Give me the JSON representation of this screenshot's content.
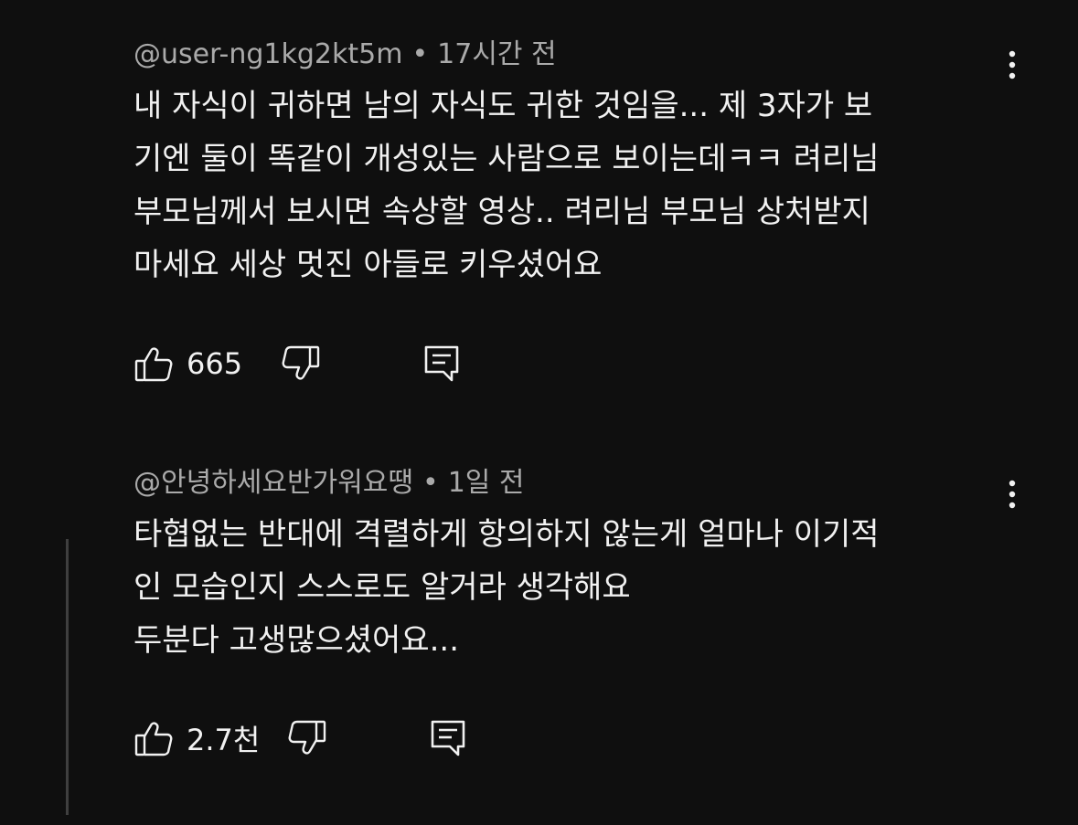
{
  "comments": [
    {
      "author": "@user-ng1kg2kt5m",
      "separator": "•",
      "time": "17시간 전",
      "text": "내 자식이 귀하면 남의 자식도 귀한 것임을... 제 3자가 보\n기엔 둘이 똑같이 개성있는 사람으로 보이는데ㅋㅋ 려리님\n부모님께서 보시면 속상할 영상.. 려리님 부모님 상처받지\n마세요 세상 멋진 아들로 키우셨어요",
      "likes": "665"
    },
    {
      "author": "@안녕하세요반가워요땡",
      "separator": "•",
      "time": "1일 전",
      "text": "타협없는 반대에 격렬하게 항의하지 않는게 얼마나 이기적\n인 모습인지 스스로도 알거라 생각해요\n두분다 고생많으셨어요...",
      "likes": "2.7천"
    }
  ],
  "icons": {
    "like": "thumbs-up-icon",
    "dislike": "thumbs-down-icon",
    "reply": "reply-comment-icon",
    "menu": "more-vert-icon"
  },
  "colors": {
    "background": "#0f0f0f",
    "text": "#f1f1f1",
    "meta": "#aaaaaa",
    "thread_line": "#3f3f3f"
  }
}
